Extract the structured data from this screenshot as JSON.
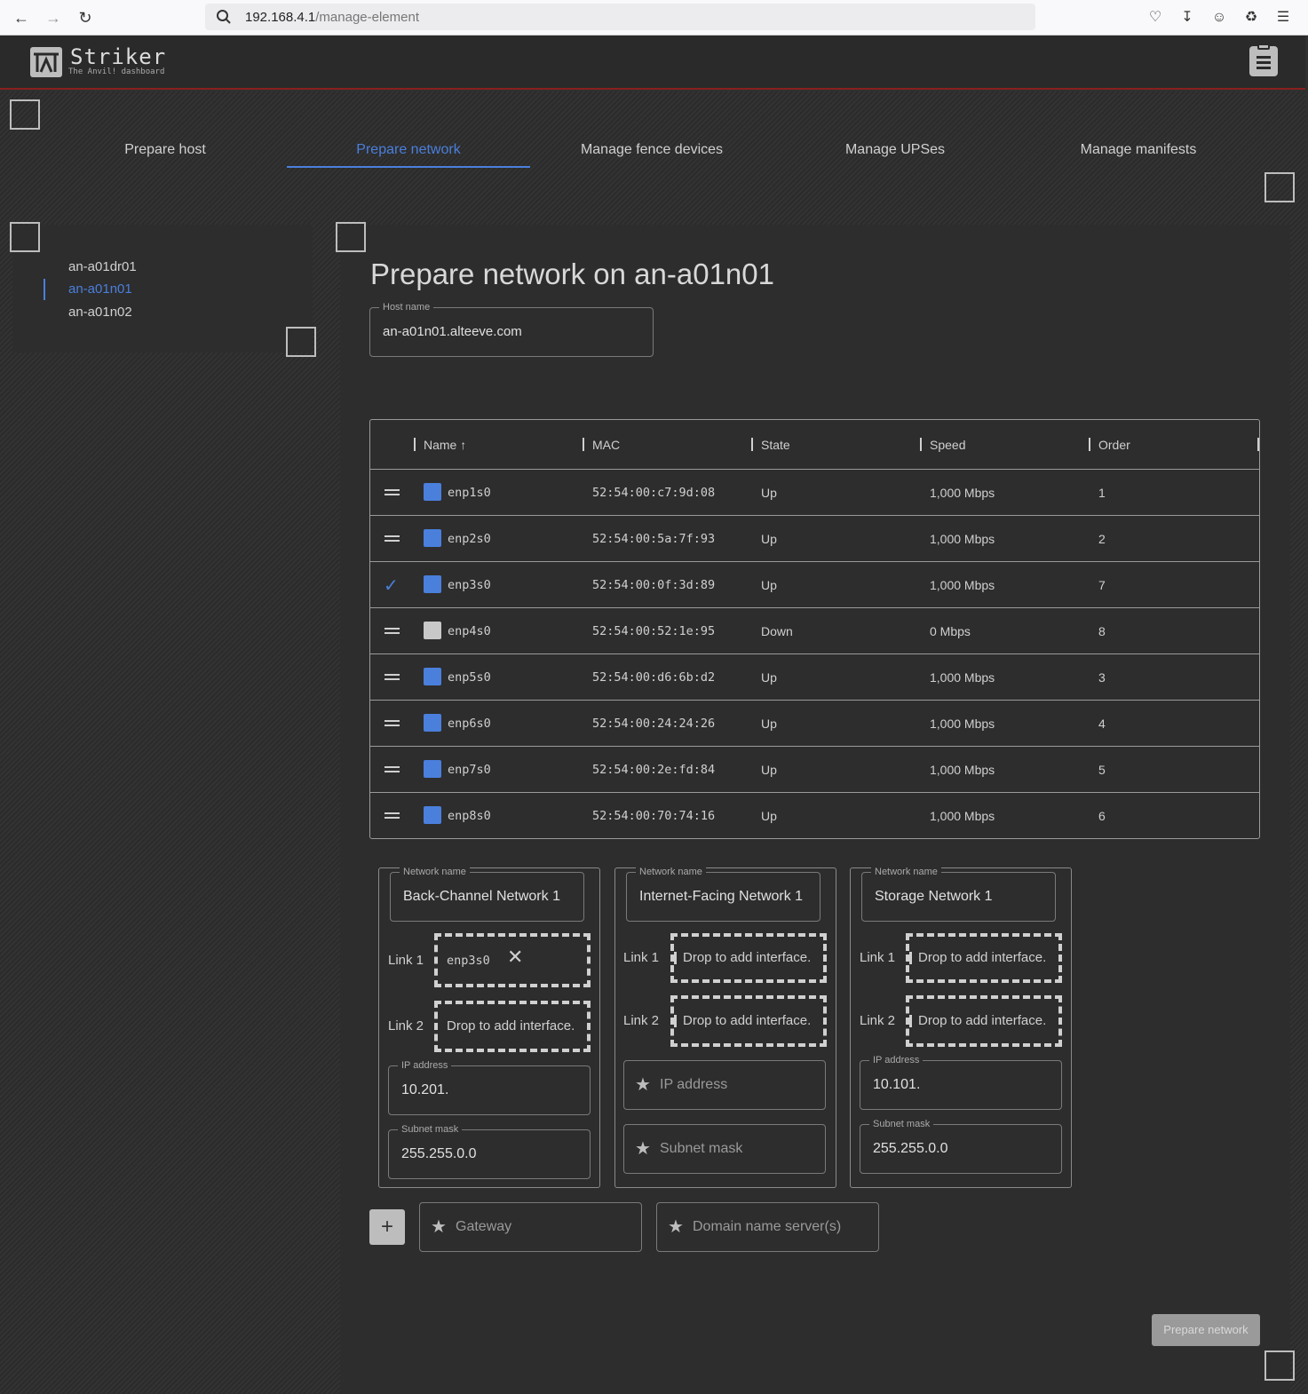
{
  "browser": {
    "url_host": "192.168.4.1",
    "url_path": "/manage-element"
  },
  "app": {
    "title": "Striker",
    "subtitle": "The Anvil! dashboard"
  },
  "tabs": [
    {
      "label": "Prepare host"
    },
    {
      "label": "Prepare network"
    },
    {
      "label": "Manage fence devices"
    },
    {
      "label": "Manage UPSes"
    },
    {
      "label": "Manage manifests"
    }
  ],
  "hosts": [
    {
      "label": "an-a01dr01"
    },
    {
      "label": "an-a01n01"
    },
    {
      "label": "an-a01n02"
    }
  ],
  "form": {
    "title": "Prepare network on an-a01n01",
    "host_name_label": "Host name",
    "host_name_value": "an-a01n01.alteeve.com"
  },
  "table": {
    "headers": {
      "name": "Name",
      "mac": "MAC",
      "state": "State",
      "speed": "Speed",
      "order": "Order"
    },
    "rows": [
      {
        "name": "enp1s0",
        "mac": "52:54:00:c7:9d:08",
        "state": "Up",
        "speed": "1,000 Mbps",
        "order": "1"
      },
      {
        "name": "enp2s0",
        "mac": "52:54:00:5a:7f:93",
        "state": "Up",
        "speed": "1,000 Mbps",
        "order": "2"
      },
      {
        "name": "enp3s0",
        "mac": "52:54:00:0f:3d:89",
        "state": "Up",
        "speed": "1,000 Mbps",
        "order": "7"
      },
      {
        "name": "enp4s0",
        "mac": "52:54:00:52:1e:95",
        "state": "Down",
        "speed": "0 Mbps",
        "order": "8"
      },
      {
        "name": "enp5s0",
        "mac": "52:54:00:d6:6b:d2",
        "state": "Up",
        "speed": "1,000 Mbps",
        "order": "3"
      },
      {
        "name": "enp6s0",
        "mac": "52:54:00:24:24:26",
        "state": "Up",
        "speed": "1,000 Mbps",
        "order": "4"
      },
      {
        "name": "enp7s0",
        "mac": "52:54:00:2e:fd:84",
        "state": "Up",
        "speed": "1,000 Mbps",
        "order": "5"
      },
      {
        "name": "enp8s0",
        "mac": "52:54:00:70:74:16",
        "state": "Up",
        "speed": "1,000 Mbps",
        "order": "6"
      }
    ]
  },
  "networks": [
    {
      "name_label": "Network name",
      "name_value": "Back-Channel Network 1",
      "link1_label": "Link 1",
      "link1_value": "enp3s0",
      "link2_label": "Link 2",
      "link2_value": "Drop to add interface.",
      "ip_label": "IP address",
      "ip_value": "10.201.",
      "mask_label": "Subnet mask",
      "mask_value": "255.255.0.0"
    },
    {
      "name_label": "Network name",
      "name_value": "Internet-Facing Network 1",
      "link1_label": "Link 1",
      "link1_value": "Drop to add interface.",
      "link2_label": "Link 2",
      "link2_value": "Drop to add interface.",
      "ip_placeholder": "IP address",
      "mask_placeholder": "Subnet mask"
    },
    {
      "name_label": "Network name",
      "name_value": "Storage Network 1",
      "link1_label": "Link 1",
      "link1_value": "Drop to add interface.",
      "link2_label": "Link 2",
      "link2_value": "Drop to add interface.",
      "ip_label": "IP address",
      "ip_value": "10.101.",
      "mask_label": "Subnet mask",
      "mask_value": "255.255.0.0"
    }
  ],
  "extra": {
    "add_button": "+",
    "gateway_placeholder": "Gateway",
    "dns_placeholder": "Domain name server(s)",
    "submit_label": "Prepare network"
  },
  "colors": {
    "accent": "#4a7fdc",
    "iface_up": "#4a7fdc",
    "iface_down": "#c8c8c8",
    "header_border": "#8a1f1f"
  }
}
